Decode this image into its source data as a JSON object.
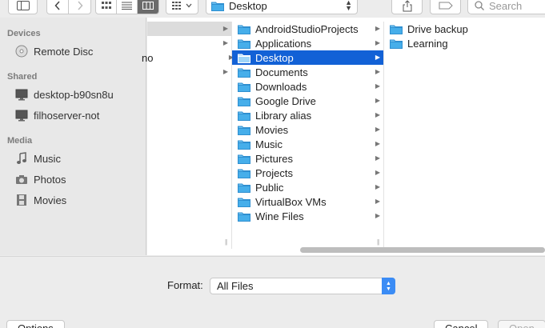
{
  "toolbar": {
    "location": "Desktop",
    "search_placeholder": "Search"
  },
  "sidebar": {
    "sections": [
      {
        "title": "Devices",
        "items": [
          {
            "label": "Remote Disc",
            "icon": "disc-icon"
          }
        ]
      },
      {
        "title": "Shared",
        "items": [
          {
            "label": "desktop-b90sn8u",
            "icon": "monitor-icon"
          },
          {
            "label": "filhoserver-not",
            "icon": "monitor-icon"
          }
        ]
      },
      {
        "title": "Media",
        "items": [
          {
            "label": "Music",
            "icon": "music-note-icon"
          },
          {
            "label": "Photos",
            "icon": "camera-icon"
          },
          {
            "label": "Movies",
            "icon": "film-icon"
          }
        ]
      }
    ]
  },
  "columns": {
    "col1": [
      "",
      "",
      "no",
      ""
    ],
    "col2": [
      {
        "label": "AndroidStudioProjects",
        "icon": "folder-icon"
      },
      {
        "label": "Applications",
        "icon": "applications-folder-icon"
      },
      {
        "label": "Desktop",
        "icon": "folder-icon",
        "selected": true
      },
      {
        "label": "Documents",
        "icon": "documents-folder-icon"
      },
      {
        "label": "Downloads",
        "icon": "downloads-folder-icon"
      },
      {
        "label": "Google Drive",
        "icon": "google-drive-folder-icon"
      },
      {
        "label": "Library alias",
        "icon": "alias-folder-icon"
      },
      {
        "label": "Movies",
        "icon": "movies-folder-icon"
      },
      {
        "label": "Music",
        "icon": "music-folder-icon"
      },
      {
        "label": "Pictures",
        "icon": "pictures-folder-icon"
      },
      {
        "label": "Projects",
        "icon": "folder-icon"
      },
      {
        "label": "Public",
        "icon": "public-folder-icon"
      },
      {
        "label": "VirtualBox VMs",
        "icon": "folder-icon"
      },
      {
        "label": "Wine Files",
        "icon": "folder-icon"
      }
    ],
    "col3": [
      {
        "label": "Drive backup",
        "icon": "folder-icon"
      },
      {
        "label": "Learning",
        "icon": "folder-icon"
      }
    ]
  },
  "format": {
    "label": "Format:",
    "value": "All Files"
  },
  "buttons": {
    "options": "Options",
    "cancel": "Cancel",
    "open": "Open"
  },
  "colors": {
    "selection": "#1261d6",
    "folder": "#39a6e8",
    "accent": "#3b8cf5"
  }
}
